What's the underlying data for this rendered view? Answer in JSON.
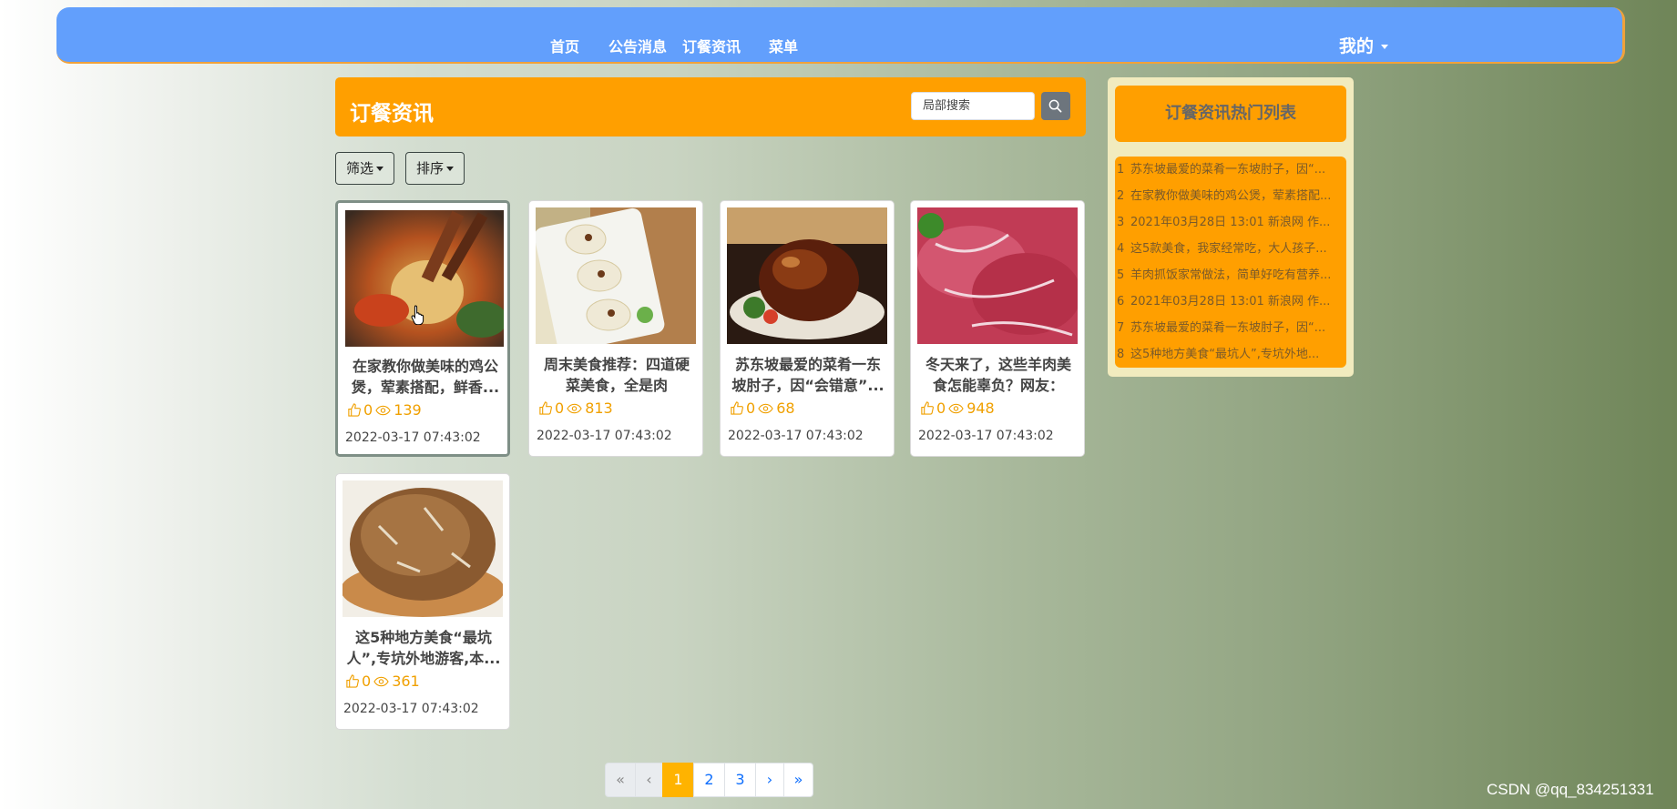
{
  "nav": {
    "items": [
      "首页",
      "公告消息",
      "订餐资讯",
      "菜单"
    ],
    "me": "我的"
  },
  "header": {
    "title": "订餐资讯",
    "search_placeholder": "局部搜索"
  },
  "filters": {
    "filter_label": "筛选",
    "sort_label": "排序"
  },
  "cards": [
    {
      "title": "在家教你做美味的鸡公煲，荤素搭配，鲜香...",
      "likes": "0",
      "views": "139",
      "date": "2022-03-17 07:43:02",
      "image": "chicken-pot"
    },
    {
      "title": "周末美食推荐：四道硬菜美食，全是肉",
      "likes": "0",
      "views": "813",
      "date": "2022-03-17 07:43:02",
      "image": "rolls"
    },
    {
      "title": "苏东坡最爱的菜肴一东坡肘子，因“会错意”...",
      "likes": "0",
      "views": "68",
      "date": "2022-03-17 07:43:02",
      "image": "pork-knuckle"
    },
    {
      "title": "冬天来了，这些羊肉美食怎能辜负？网友：现...",
      "likes": "0",
      "views": "948",
      "date": "2022-03-17 07:43:02",
      "image": "raw-lamb"
    },
    {
      "title": "这5种地方美食“最坑人”,专坑外地游客,本...",
      "likes": "0",
      "views": "361",
      "date": "2022-03-17 07:43:02",
      "image": "bread"
    }
  ],
  "hot": {
    "title": "订餐资讯热门列表",
    "items": [
      {
        "num": "1",
        "text": "苏东坡最爱的菜肴一东坡肘子，因“..."
      },
      {
        "num": "2",
        "text": "在家教你做美味的鸡公煲，荤素搭配..."
      },
      {
        "num": "3",
        "text": "2021年03月28日 13:01 新浪网 作..."
      },
      {
        "num": "4",
        "text": "这5款美食，我家经常吃，大人孩子..."
      },
      {
        "num": "5",
        "text": "羊肉抓饭家常做法，简单好吃有营养..."
      },
      {
        "num": "6",
        "text": "2021年03月28日 13:01 新浪网 作..."
      },
      {
        "num": "7",
        "text": "苏东坡最爱的菜肴一东坡肘子，因“..."
      },
      {
        "num": "8",
        "text": "这5种地方美食“最坑人”,专坑外地..."
      }
    ]
  },
  "pager": {
    "first": "«",
    "prev": "‹",
    "pages": [
      "1",
      "2",
      "3"
    ],
    "current": "1",
    "next": "›",
    "last": "»"
  },
  "watermark": "CSDN @qq_834251331",
  "colors": {
    "nav": "#629ffc",
    "accent": "#ff9f00",
    "hot_bg": "#f1ebbe"
  }
}
